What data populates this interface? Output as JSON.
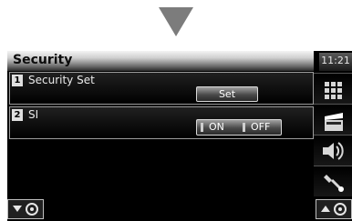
{
  "screen": {
    "title": "Security",
    "clock": "11:21"
  },
  "rows": [
    {
      "num": "1",
      "label": "Security Set",
      "button": "Set"
    },
    {
      "num": "2",
      "label": "SI",
      "on": "ON",
      "off": "OFF"
    }
  ]
}
